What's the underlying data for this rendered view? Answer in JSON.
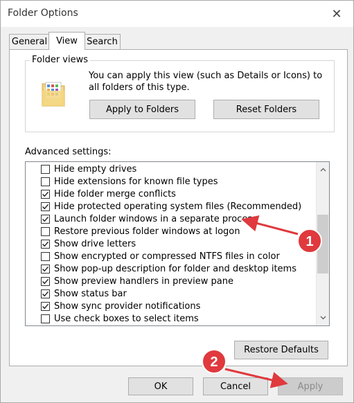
{
  "window": {
    "title": "Folder Options",
    "close_glyph": "✕"
  },
  "tabs": [
    {
      "label": "General",
      "active": false
    },
    {
      "label": "View",
      "active": true
    },
    {
      "label": "Search",
      "active": false
    }
  ],
  "folder_views": {
    "label": "Folder views",
    "description": "You can apply this view (such as Details or Icons) to all folders of this type.",
    "apply_button": "Apply to Folders",
    "reset_button": "Reset Folders",
    "icon": "folder-icon"
  },
  "advanced": {
    "label": "Advanced settings:",
    "items": [
      {
        "label": "Hide empty drives",
        "checked": false
      },
      {
        "label": "Hide extensions for known file types",
        "checked": false
      },
      {
        "label": "Hide folder merge conflicts",
        "checked": true
      },
      {
        "label": "Hide protected operating system files (Recommended)",
        "checked": true
      },
      {
        "label": "Launch folder windows in a separate process",
        "checked": true
      },
      {
        "label": "Restore previous folder windows at logon",
        "checked": false
      },
      {
        "label": "Show drive letters",
        "checked": true
      },
      {
        "label": "Show encrypted or compressed NTFS files in color",
        "checked": false
      },
      {
        "label": "Show pop-up description for folder and desktop items",
        "checked": true
      },
      {
        "label": "Show preview handlers in preview pane",
        "checked": true
      },
      {
        "label": "Show status bar",
        "checked": true
      },
      {
        "label": "Show sync provider notifications",
        "checked": true
      },
      {
        "label": "Use check boxes to select items",
        "checked": false
      }
    ],
    "restore_button": "Restore Defaults"
  },
  "footer": {
    "ok": "OK",
    "cancel": "Cancel",
    "apply": "Apply"
  },
  "annotations": [
    {
      "number": "1",
      "color": "#e0393e"
    },
    {
      "number": "2",
      "color": "#e0393e"
    }
  ]
}
